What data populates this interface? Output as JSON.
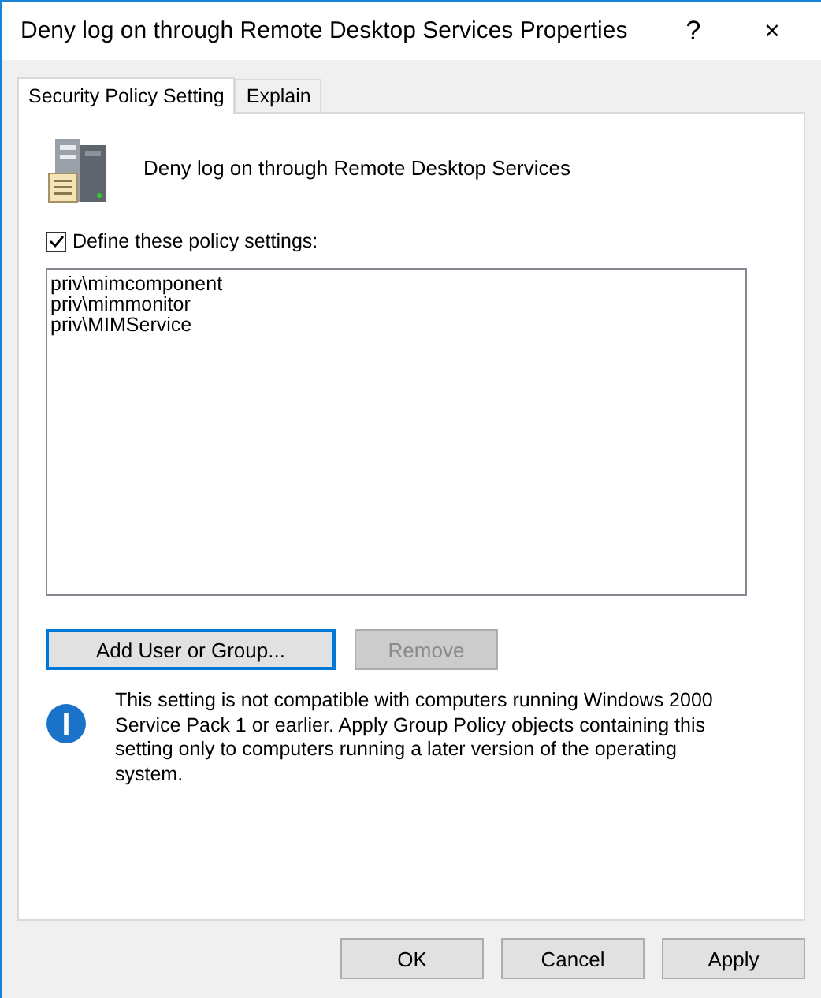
{
  "window": {
    "title": "Deny log on through Remote Desktop Services Properties",
    "help": "?",
    "close": "×"
  },
  "tabs": [
    {
      "label": "Security Policy Setting",
      "selected": true
    },
    {
      "label": "Explain",
      "selected": false
    }
  ],
  "policy_name": "Deny log on through Remote Desktop Services",
  "define_checkbox": {
    "label": "Define these policy settings:",
    "checked": true
  },
  "accounts": [
    "priv\\mimcomponent",
    "priv\\mimmonitor",
    "priv\\MIMService"
  ],
  "list_buttons": [
    {
      "label": "Add User or Group...",
      "disabled": false,
      "focused": true
    },
    {
      "label": "Remove",
      "disabled": true,
      "focused": false
    }
  ],
  "info_text": "This setting is not compatible with computers running Windows 2000 Service Pack 1 or earlier.  Apply Group Policy objects containing this setting only to computers running a later version of the operating system.",
  "buttons": [
    "OK",
    "Cancel",
    "Apply"
  ]
}
